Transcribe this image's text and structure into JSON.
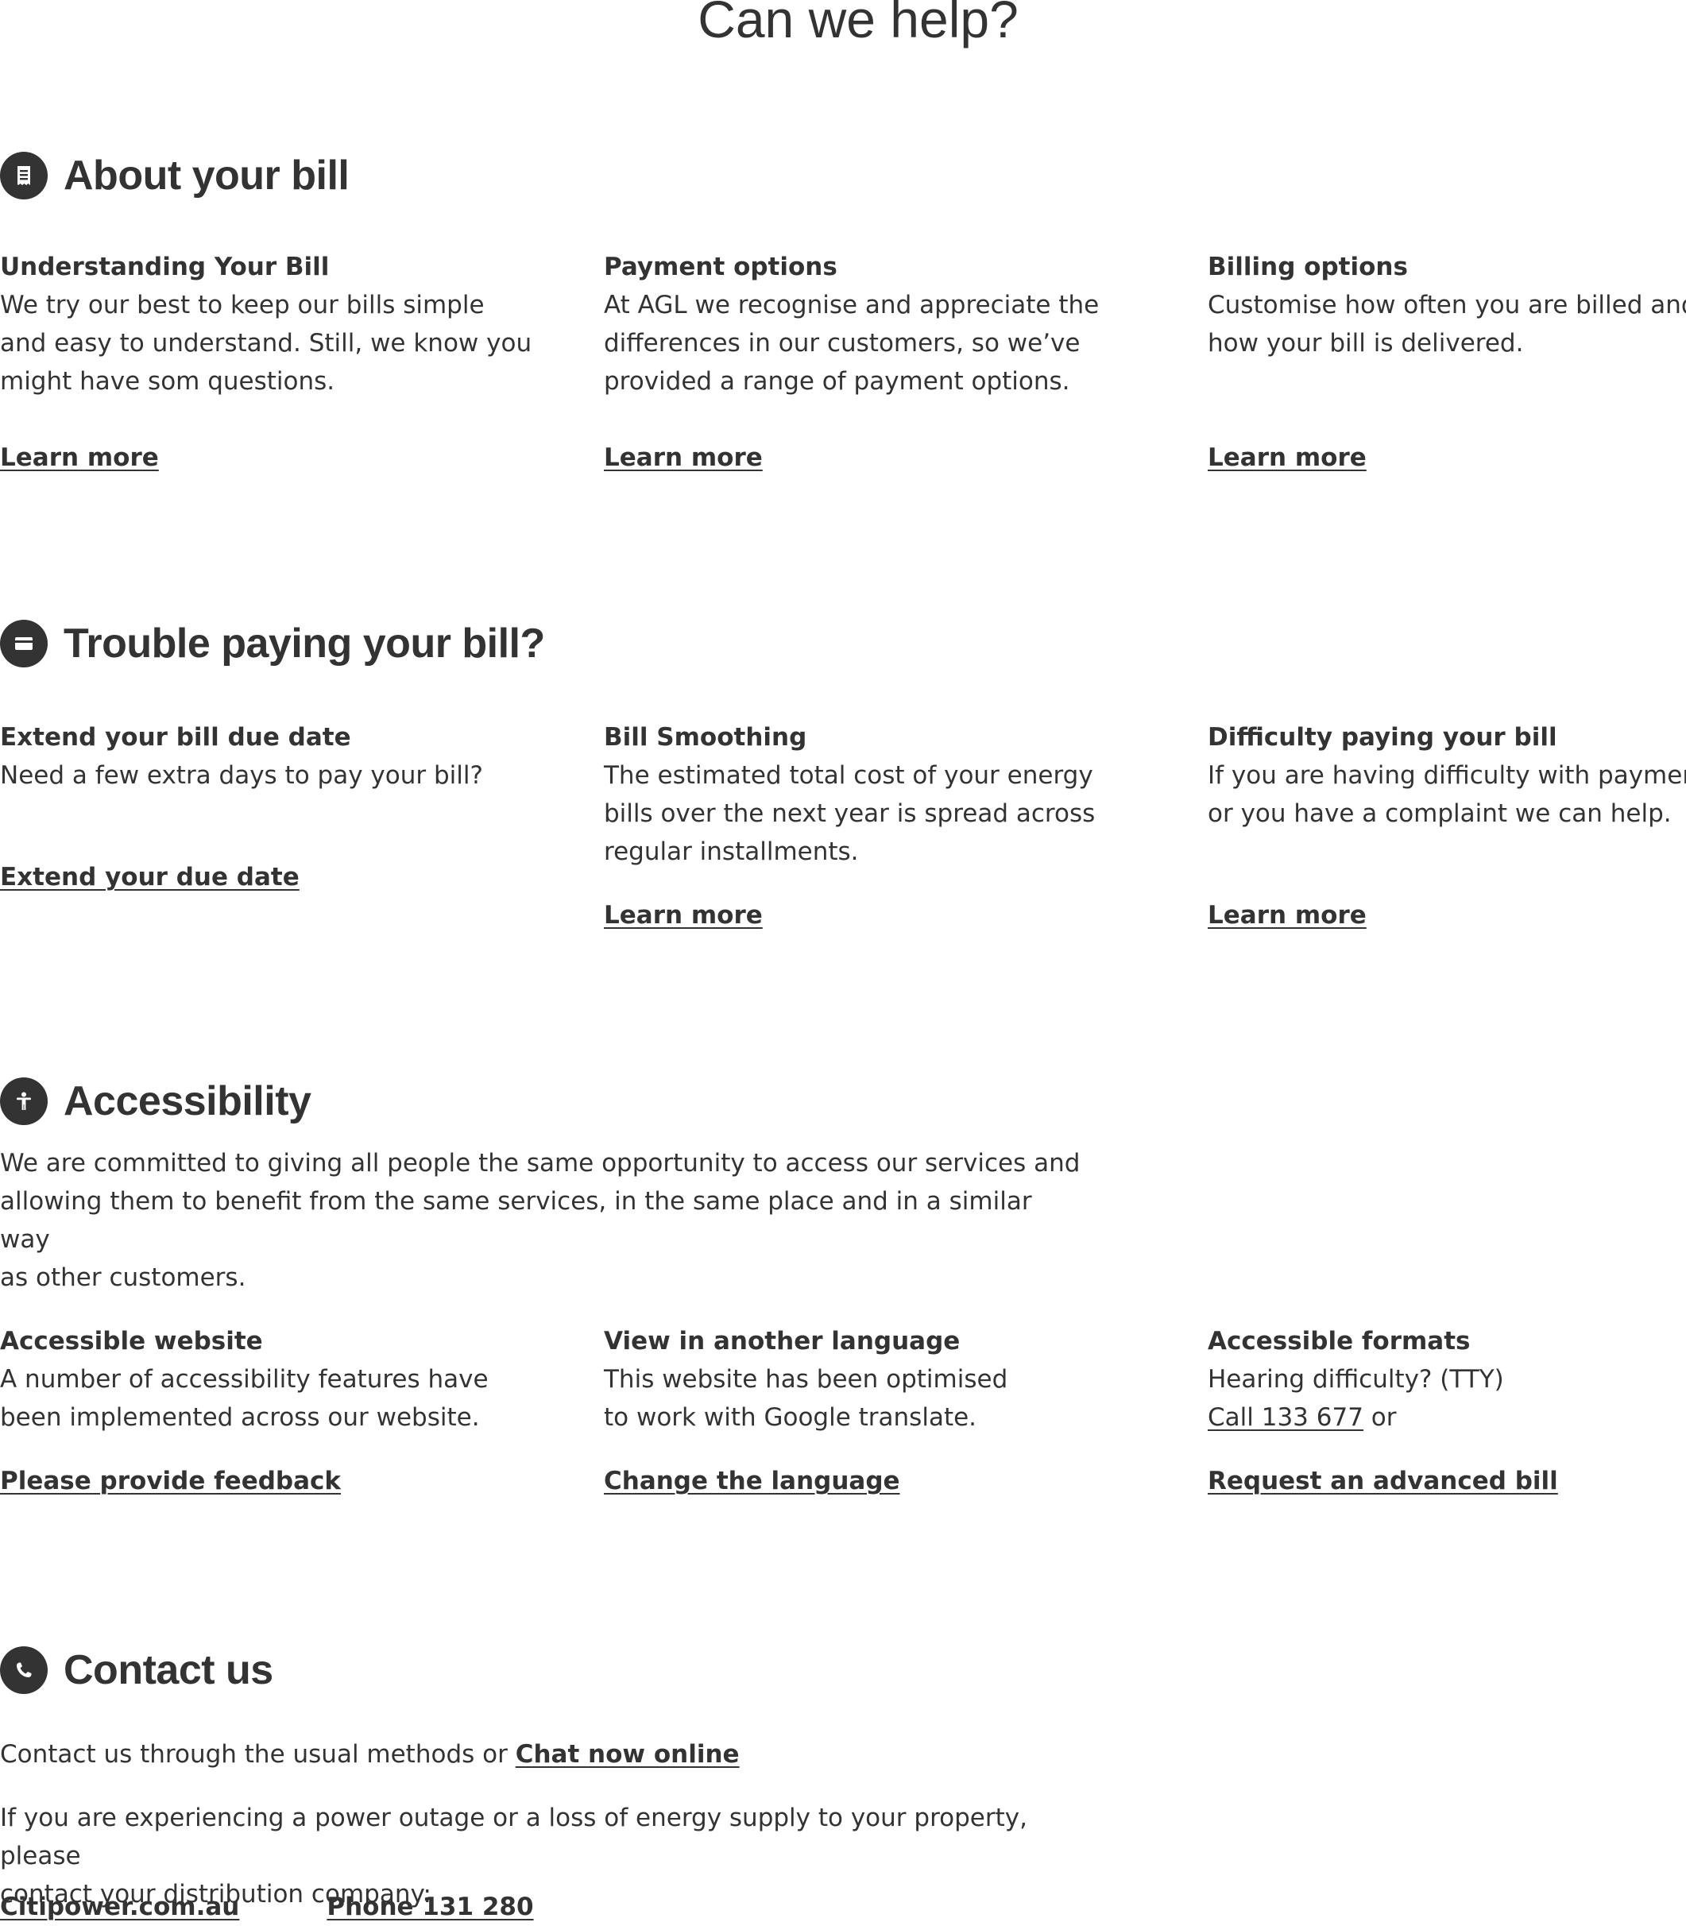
{
  "page": {
    "title": "Can we help?"
  },
  "about_bill": {
    "heading": "About your bill",
    "icon": "receipt-icon",
    "cards": [
      {
        "title": "Understanding Your Bill",
        "text": "We try our best to keep our bills simple\nand easy to understand. Still, we know you\nmight have som questions.",
        "link": "Learn more"
      },
      {
        "title": "Payment options",
        "text": "At AGL we recognise and appreciate the\ndifferences in our customers, so we’ve\nprovided a range of payment options.",
        "link": "Learn more"
      },
      {
        "title": "Billing options",
        "text": "Customise how often you are billed and\nhow your bill is delivered.",
        "link": "Learn more"
      }
    ]
  },
  "trouble_paying": {
    "heading": "Trouble paying your bill?",
    "icon": "card-icon",
    "cards": [
      {
        "title": "Extend your bill due date",
        "text": "Need a few extra days to pay your bill?",
        "link": "Extend your due date"
      },
      {
        "title": "Bill Smoothing",
        "text": "The estimated total cost of your energy\nbills over the next year is spread across\nregular installments.",
        "link": "Learn more"
      },
      {
        "title": "Difficulty paying your bill",
        "text": "If you are having difficulty with payment,\nor you have a complaint we can help.",
        "link": "Learn more"
      }
    ]
  },
  "accessibility": {
    "heading": "Accessibility",
    "icon": "accessibility-icon",
    "intro": "We are committed to giving all people the same opportunity to access our services and\nallowing them to benefit from the same services, in the same place and in a similar way\nas other customers.",
    "cards": [
      {
        "title": "Accessible website",
        "text": "A number of accessibility features have\nbeen implemented across our website.",
        "link": "Please provide feedback"
      },
      {
        "title": "View in another language",
        "text": "This website has been optimised\nto work with Google translate.",
        "link": "Change the language"
      },
      {
        "title": "Accessible formats",
        "text": "Hearing difficulty? (TTY)",
        "call_link": "Call 133 677",
        "call_suffix": " or",
        "link": "Request an advanced bill"
      }
    ]
  },
  "contact": {
    "heading": "Contact us",
    "icon": "phone-icon",
    "methods_text": "Contact us through the usual methods or ",
    "chat_link": "Chat now online",
    "outage_text": "If you are experiencing a power outage or a loss of energy supply to your property, please\ncontact your distribution company:",
    "distributor_link": "Citipower.com.au",
    "phone_link": "Phone 131 280"
  }
}
